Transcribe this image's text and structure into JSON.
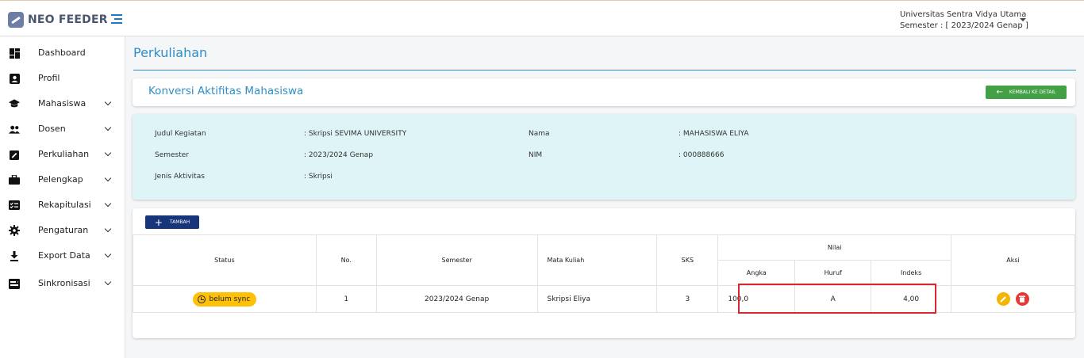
{
  "app": {
    "name": "NEO FEEDER"
  },
  "header": {
    "university": "Universitas Sentra Vidya Utama",
    "semester": "Semester : [ 2023/2024 Genap ]"
  },
  "sidebar": {
    "items": [
      {
        "label": "Dashboard",
        "icon": "dashboard-icon"
      },
      {
        "label": "Profil",
        "icon": "profile-icon"
      },
      {
        "label": "Mahasiswa",
        "icon": "graduation-cap-icon"
      },
      {
        "label": "Dosen",
        "icon": "people-icon"
      },
      {
        "label": "Perkuliahan",
        "icon": "assignment-icon"
      },
      {
        "label": "Pelengkap",
        "icon": "briefcase-icon"
      },
      {
        "label": "Rekapitulasi",
        "icon": "checklist-icon"
      },
      {
        "label": "Pengaturan",
        "icon": "gear-icon"
      },
      {
        "label": "Export Data",
        "icon": "download-icon"
      },
      {
        "label": "Sinkronisasi",
        "icon": "sync-icon"
      }
    ]
  },
  "page": {
    "title": "Perkuliahan"
  },
  "card": {
    "title": "Konversi Aktifitas Mahasiswa",
    "back_button": "KEMBALI KE DETAIL"
  },
  "info": {
    "judul_label": "Judul Kegiatan",
    "judul_value": ": Skripsi SEVIMA UNIVERSITY",
    "semester_label": "Semester",
    "semester_value": ": 2023/2024 Genap",
    "jenis_label": "Jenis Aktivitas",
    "jenis_value": ": Skripsi",
    "nama_label": "Nama",
    "nama_value": ": MAHASISWA ELIYA",
    "nim_label": "NIM",
    "nim_value": ": 000888666"
  },
  "table": {
    "add_button": "TAMBAH",
    "headers": {
      "status": "Status",
      "no": "No.",
      "semester": "Semester",
      "mata_kuliah": "Mata Kuliah",
      "sks": "SKS",
      "nilai": "Nilai",
      "angka": "Angka",
      "huruf": "Huruf",
      "indeks": "Indeks",
      "aksi": "Aksi"
    },
    "rows": [
      {
        "status": "belum sync",
        "no": "1",
        "semester": "2023/2024 Genap",
        "mata_kuliah": "Skripsi Eliya",
        "sks": "3",
        "angka": "100,0",
        "huruf": "A",
        "indeks": "4,00"
      }
    ]
  },
  "colors": {
    "accent": "#2f8fc4",
    "green": "#43a047",
    "navy": "#17357a",
    "badge": "#ffc107",
    "edit": "#f4b400",
    "delete": "#e53935",
    "highlight": "#d8262e"
  }
}
